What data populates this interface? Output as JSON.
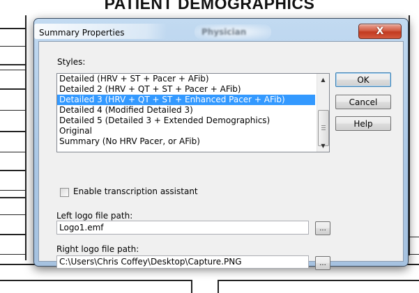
{
  "background": {
    "title": "PATIENT DEMOGRAPHICS"
  },
  "dialog": {
    "title": "Summary Properties",
    "ghost_title": "Physician",
    "close_glyph": "X",
    "styles_label": "Styles:",
    "styles": [
      {
        "label": "Detailed (HRV + ST + Pacer + AFib)",
        "selected": false
      },
      {
        "label": "Detailed 2 (HRV + QT + ST + Pacer + AFib)",
        "selected": false
      },
      {
        "label": "Detailed 3 (HRV + QT + ST + Enhanced Pacer + AFib)",
        "selected": true
      },
      {
        "label": "Detailed 4 (Modified Detailed 3)",
        "selected": false
      },
      {
        "label": "Detailed 5 (Detailed 3 + Extended Demographics)",
        "selected": false
      },
      {
        "label": "Original",
        "selected": false
      },
      {
        "label": "Summary (No HRV Pacer, or AFib)",
        "selected": false
      }
    ],
    "buttons": {
      "ok": "OK",
      "cancel": "Cancel",
      "help": "Help"
    },
    "transcription_checkbox": {
      "label": "Enable transcription assistant",
      "checked": false
    },
    "left_logo": {
      "label": "Left logo file path:",
      "value": "Logo1.emf",
      "browse": "..."
    },
    "right_logo": {
      "label": "Right logo file path:",
      "value": "C:\\Users\\Chris Coffey\\Desktop\\Capture.PNG",
      "browse": "..."
    },
    "scrollbar": {
      "up_glyph": "▲",
      "down_glyph": "▼"
    }
  },
  "colors": {
    "selection": "#3399ff",
    "dialog_frame": "#b9d1ea",
    "close_button": "#c9452a"
  }
}
